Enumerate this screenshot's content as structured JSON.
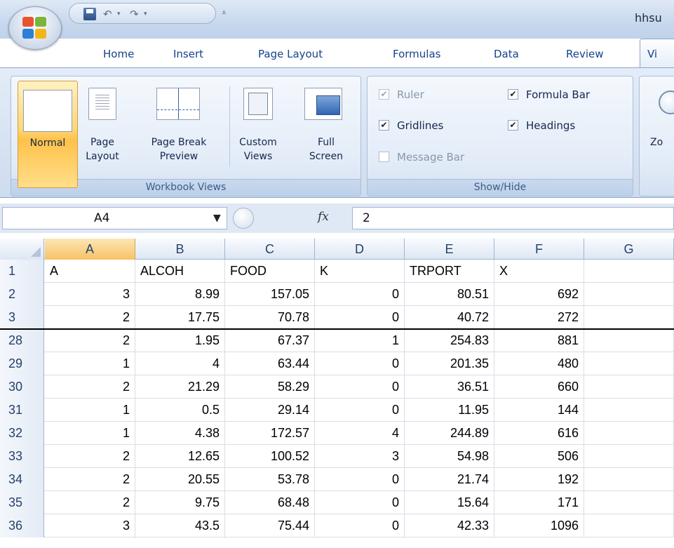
{
  "window": {
    "title": "hhsu"
  },
  "quick_access": {
    "icons": [
      "save-icon",
      "undo-icon",
      "redo-icon",
      "customize-icon"
    ]
  },
  "tabs": [
    "Home",
    "Insert",
    "Page Layout",
    "Formulas",
    "Data",
    "Review",
    "Vi"
  ],
  "ribbon": {
    "workbook_views": {
      "label": "Workbook Views",
      "normal": "Normal",
      "page_layout_1": "Page",
      "page_layout_2": "Layout",
      "page_break_1": "Page Break",
      "page_break_2": "Preview",
      "custom_views_1": "Custom",
      "custom_views_2": "Views",
      "full_screen_1": "Full",
      "full_screen_2": "Screen"
    },
    "show_hide": {
      "label": "Show/Hide",
      "ruler": "Ruler",
      "gridlines": "Gridlines",
      "message_bar": "Message Bar",
      "formula_bar": "Formula Bar",
      "headings": "Headings",
      "ruler_checked": true,
      "gridlines_checked": true,
      "message_bar_checked": false,
      "formula_bar_checked": true,
      "headings_checked": true
    },
    "zoom": {
      "label": "Zo"
    }
  },
  "formula_bar": {
    "name_box": "A4",
    "fx": "fx",
    "value": "2"
  },
  "sheet": {
    "columns": [
      "A",
      "B",
      "C",
      "D",
      "E",
      "F",
      "G"
    ],
    "selected_column": "A",
    "rows": [
      {
        "num": "1",
        "cells": [
          "A",
          "ALCOH",
          "FOOD",
          "K",
          "TRPORT",
          "X",
          ""
        ]
      },
      {
        "num": "2",
        "cells": [
          "3",
          "8.99",
          "157.05",
          "0",
          "80.51",
          "692",
          ""
        ]
      },
      {
        "num": "3",
        "cells": [
          "2",
          "17.75",
          "70.78",
          "0",
          "40.72",
          "272",
          ""
        ]
      },
      {
        "num": "28",
        "cells": [
          "2",
          "1.95",
          "67.37",
          "1",
          "254.83",
          "881",
          ""
        ]
      },
      {
        "num": "29",
        "cells": [
          "1",
          "4",
          "63.44",
          "0",
          "201.35",
          "480",
          ""
        ]
      },
      {
        "num": "30",
        "cells": [
          "2",
          "21.29",
          "58.29",
          "0",
          "36.51",
          "660",
          ""
        ]
      },
      {
        "num": "31",
        "cells": [
          "1",
          "0.5",
          "29.14",
          "0",
          "11.95",
          "144",
          ""
        ]
      },
      {
        "num": "32",
        "cells": [
          "1",
          "4.38",
          "172.57",
          "4",
          "244.89",
          "616",
          ""
        ]
      },
      {
        "num": "33",
        "cells": [
          "2",
          "12.65",
          "100.52",
          "3",
          "54.98",
          "506",
          ""
        ]
      },
      {
        "num": "34",
        "cells": [
          "2",
          "20.55",
          "53.78",
          "0",
          "21.74",
          "192",
          ""
        ]
      },
      {
        "num": "35",
        "cells": [
          "2",
          "9.75",
          "68.48",
          "0",
          "15.64",
          "171",
          ""
        ]
      },
      {
        "num": "36",
        "cells": [
          "3",
          "43.5",
          "75.44",
          "0",
          "42.33",
          "1096",
          ""
        ]
      }
    ]
  }
}
